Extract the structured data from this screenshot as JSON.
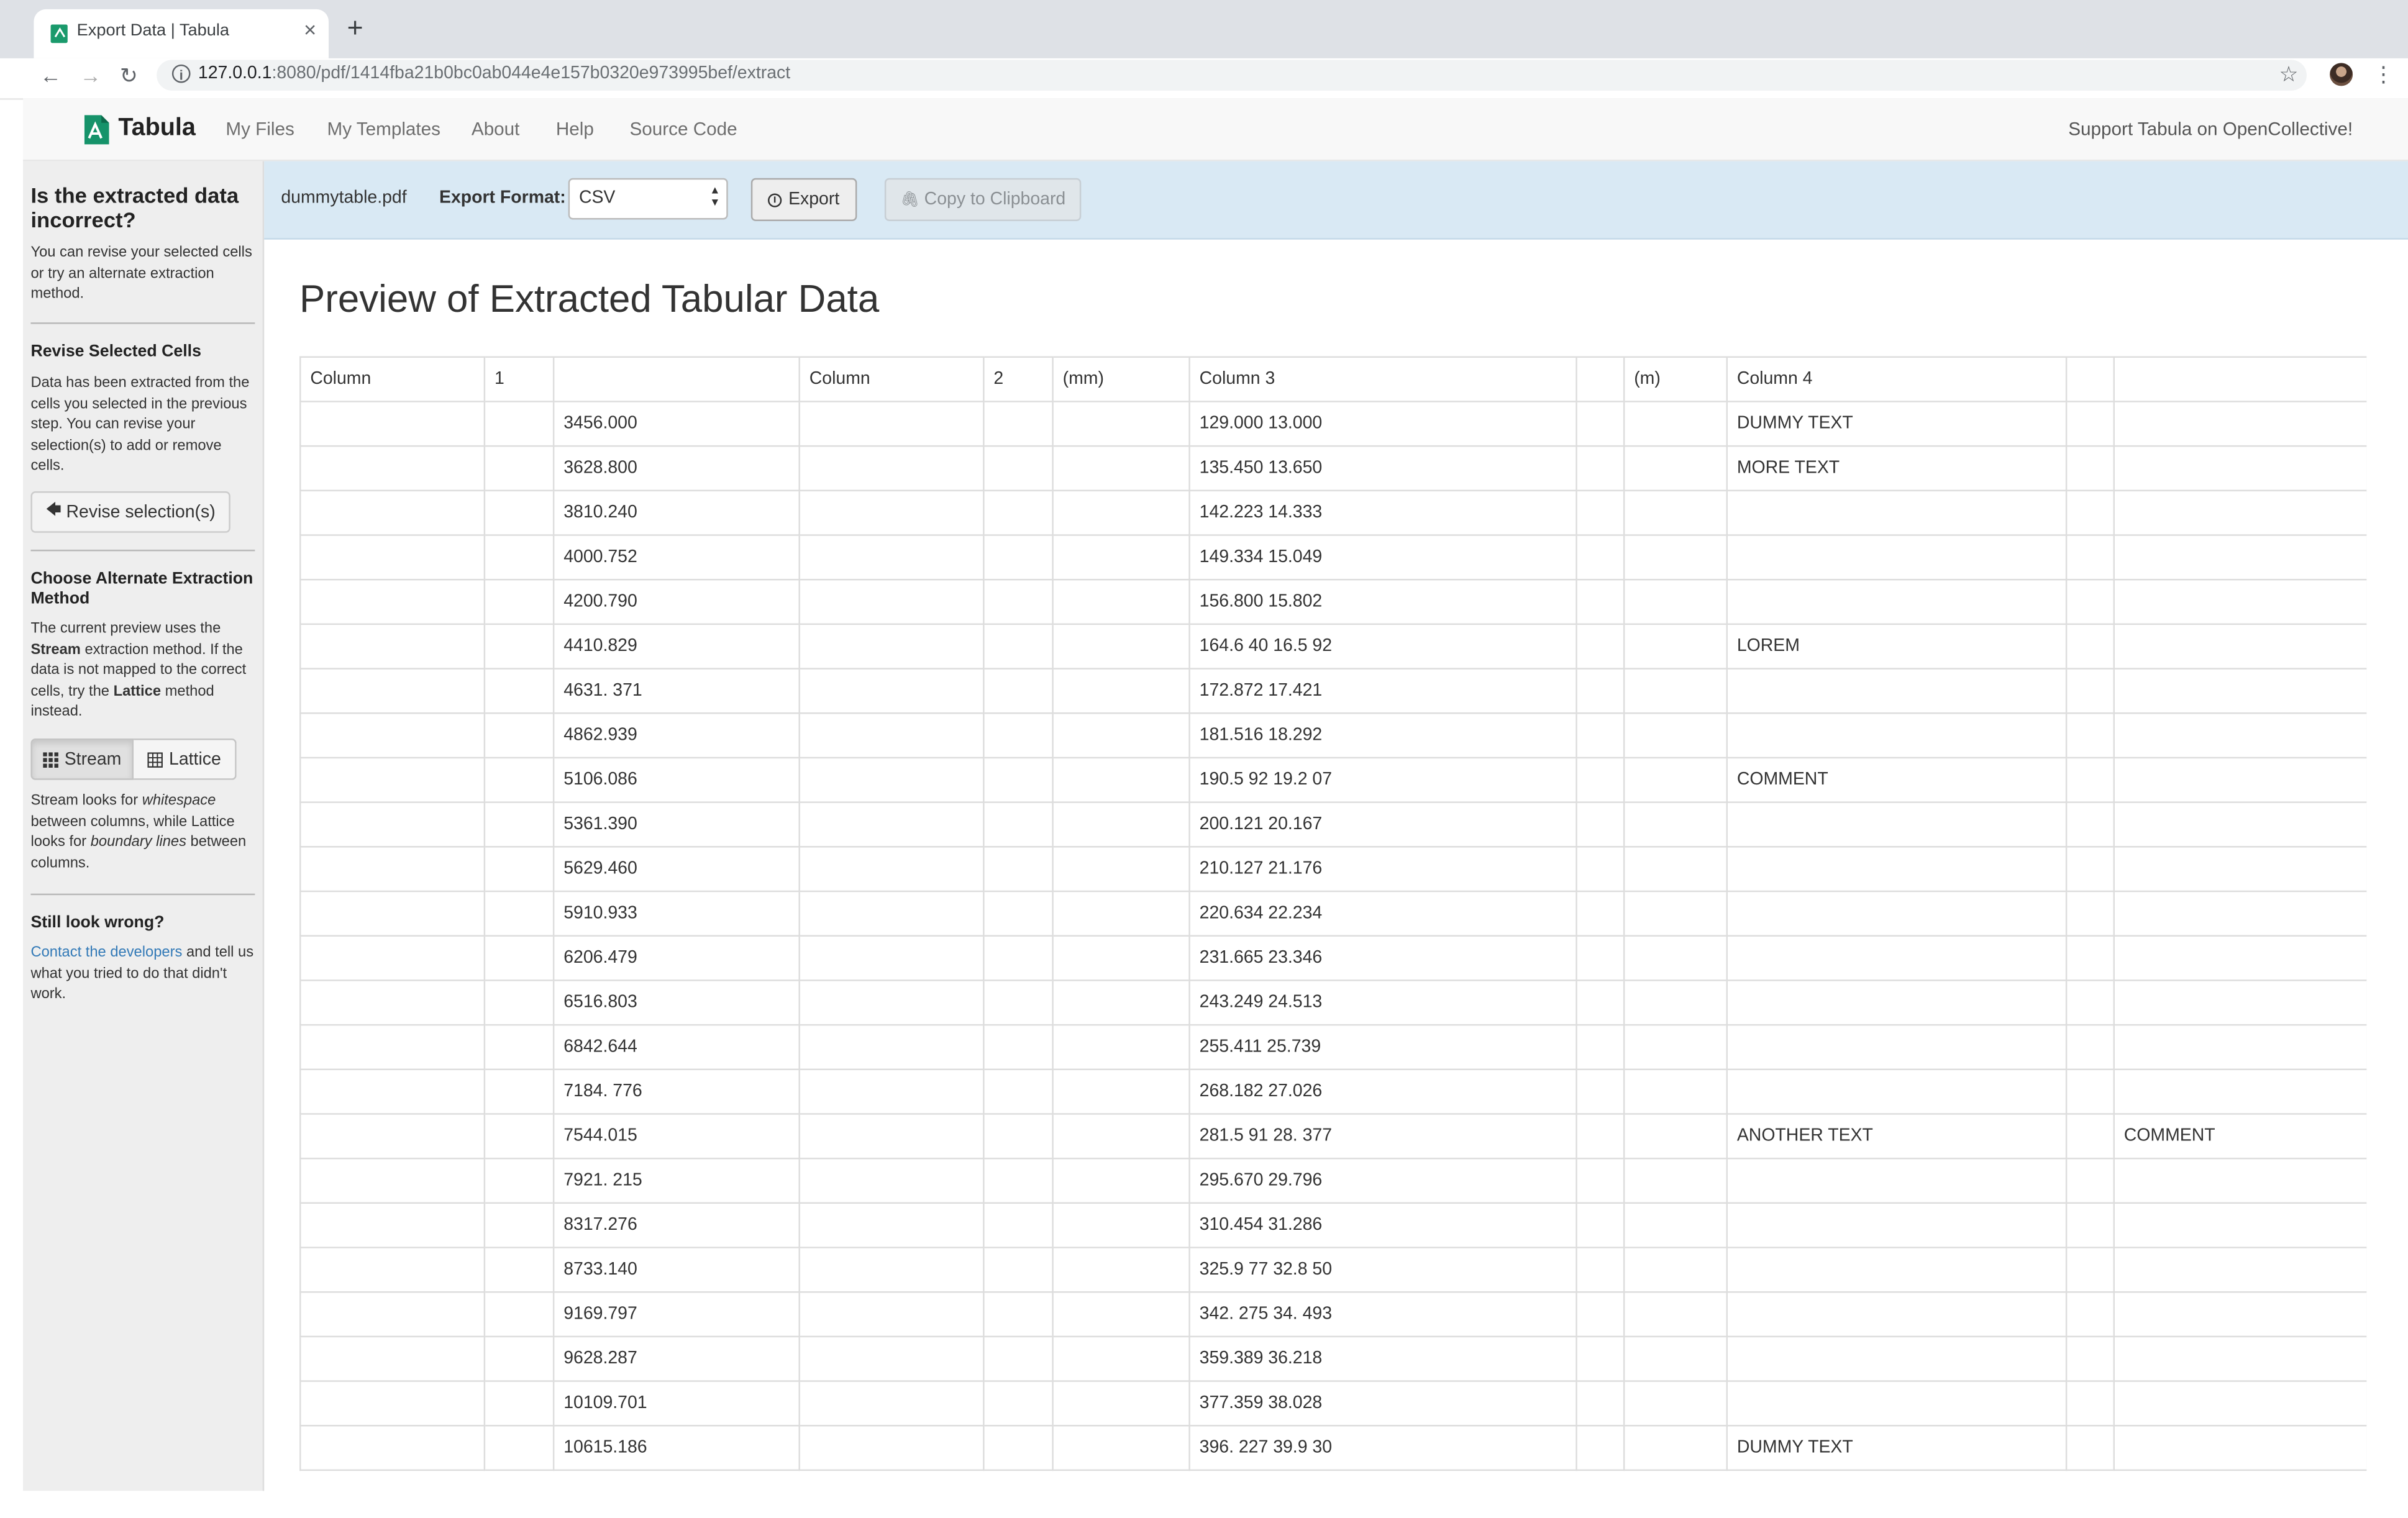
{
  "browser": {
    "tab_title": "Export Data | Tabula",
    "tab_close": "×",
    "new_tab": "+",
    "url_host": "127.0.0.1",
    "url_path": ":8080/pdf/1414fba21b0bc0ab044e4e157b0320e973995bef/extract",
    "back": "←",
    "forward": "→",
    "reload": "↻",
    "bookmark": "☆",
    "menu": "⋮"
  },
  "navbar": {
    "brand": "Tabula",
    "links": [
      "My Files",
      "My Templates",
      "About",
      "Help",
      "Source Code"
    ],
    "support": "Support Tabula on OpenCollective!"
  },
  "sidebar": {
    "heading": "Is the extracted data incorrect?",
    "intro": "You can revise your selected cells or try an alternate extraction method.",
    "revise_heading": "Revise Selected Cells",
    "revise_text": "Data has been extracted from the cells you selected in the previous step. You can revise your selection(s) to add or remove cells.",
    "revise_button": "Revise selection(s)",
    "revise_arrow": "🡄",
    "method_heading": "Choose Alternate Extraction Method",
    "method_text_1": "The current preview uses the ",
    "method_current": "Stream",
    "method_text_2": " extraction method. If the data is not mapped to the correct cells, try the ",
    "method_alt": "Lattice",
    "method_text_3": " method instead.",
    "stream_button": "Stream",
    "lattice_button": "Lattice",
    "explain_1": "Stream looks for ",
    "explain_whitespace": "whitespace",
    "explain_2": " between columns, while Lattice looks for ",
    "explain_boundary": "boundary lines",
    "explain_3": " between columns.",
    "wrong_heading": "Still look wrong?",
    "contact_link": "Contact the developers",
    "contact_text": " and tell us what you tried to do that didn't work."
  },
  "controls": {
    "filename": "dummytable.pdf",
    "format_label": "Export Format:",
    "format_value": "CSV",
    "export_button": "Export",
    "copy_button": "Copy to Clipboard",
    "copy_icon": "🖇"
  },
  "main": {
    "title": "Preview of Extracted Tabular Data"
  },
  "table": {
    "rows": [
      [
        "Column",
        "1",
        "",
        "Column",
        "2",
        "(mm)",
        "Column 3",
        "",
        "(m)",
        "Column 4",
        "",
        ""
      ],
      [
        "",
        "",
        "3456.000",
        "",
        "",
        "",
        "129.000 13.000",
        "",
        "",
        "DUMMY TEXT",
        "",
        ""
      ],
      [
        "",
        "",
        "3628.800",
        "",
        "",
        "",
        "135.450 13.650",
        "",
        "",
        "MORE TEXT",
        "",
        ""
      ],
      [
        "",
        "",
        "3810.240",
        "",
        "",
        "",
        "142.223 14.333",
        "",
        "",
        "",
        "",
        ""
      ],
      [
        "",
        "",
        "4000.752",
        "",
        "",
        "",
        "149.334 15.049",
        "",
        "",
        "",
        "",
        ""
      ],
      [
        "",
        "",
        "4200.790",
        "",
        "",
        "",
        "156.800 15.802",
        "",
        "",
        "",
        "",
        ""
      ],
      [
        "",
        "",
        "4410.829",
        "",
        "",
        "",
        "164.6 40 16.5 92",
        "",
        "",
        "LOREM",
        "",
        ""
      ],
      [
        "",
        "",
        "4631. 371",
        "",
        "",
        "",
        "172.872 17.421",
        "",
        "",
        "",
        "",
        ""
      ],
      [
        "",
        "",
        "4862.939",
        "",
        "",
        "",
        "181.516 18.292",
        "",
        "",
        "",
        "",
        ""
      ],
      [
        "",
        "",
        "5106.086",
        "",
        "",
        "",
        "190.5 92 19.2 07",
        "",
        "",
        "COMMENT",
        "",
        ""
      ],
      [
        "",
        "",
        "5361.390",
        "",
        "",
        "",
        "200.121 20.167",
        "",
        "",
        "",
        "",
        ""
      ],
      [
        "",
        "",
        "5629.460",
        "",
        "",
        "",
        "210.127 21.176",
        "",
        "",
        "",
        "",
        ""
      ],
      [
        "",
        "",
        "5910.933",
        "",
        "",
        "",
        "220.634 22.234",
        "",
        "",
        "",
        "",
        ""
      ],
      [
        "",
        "",
        "6206.479",
        "",
        "",
        "",
        "231.665 23.346",
        "",
        "",
        "",
        "",
        ""
      ],
      [
        "",
        "",
        "6516.803",
        "",
        "",
        "",
        "243.249 24.513",
        "",
        "",
        "",
        "",
        ""
      ],
      [
        "",
        "",
        "6842.644",
        "",
        "",
        "",
        "255.411 25.739",
        "",
        "",
        "",
        "",
        ""
      ],
      [
        "",
        "",
        "7184. 776",
        "",
        "",
        "",
        "268.182 27.026",
        "",
        "",
        "",
        "",
        ""
      ],
      [
        "",
        "",
        "7544.015",
        "",
        "",
        "",
        "281.5 91 28. 377",
        "",
        "",
        "ANOTHER TEXT",
        "",
        "COMMENT"
      ],
      [
        "",
        "",
        "7921. 215",
        "",
        "",
        "",
        "295.670 29.796",
        "",
        "",
        "",
        "",
        ""
      ],
      [
        "",
        "",
        "8317.276",
        "",
        "",
        "",
        "310.454 31.286",
        "",
        "",
        "",
        "",
        ""
      ],
      [
        "",
        "",
        "8733.140",
        "",
        "",
        "",
        "325.9 77 32.8 50",
        "",
        "",
        "",
        "",
        ""
      ],
      [
        "",
        "",
        "9169.797",
        "",
        "",
        "",
        "342. 275 34. 493",
        "",
        "",
        "",
        "",
        ""
      ],
      [
        "",
        "",
        "9628.287",
        "",
        "",
        "",
        "359.389 36.218",
        "",
        "",
        "",
        "",
        ""
      ],
      [
        "",
        "",
        "10109.701",
        "",
        "",
        "",
        "377.359 38.028",
        "",
        "",
        "",
        "",
        ""
      ],
      [
        "",
        "",
        "10615.186",
        "",
        "",
        "",
        "396. 227 39.9 30",
        "",
        "",
        "DUMMY TEXT",
        "",
        ""
      ]
    ]
  }
}
